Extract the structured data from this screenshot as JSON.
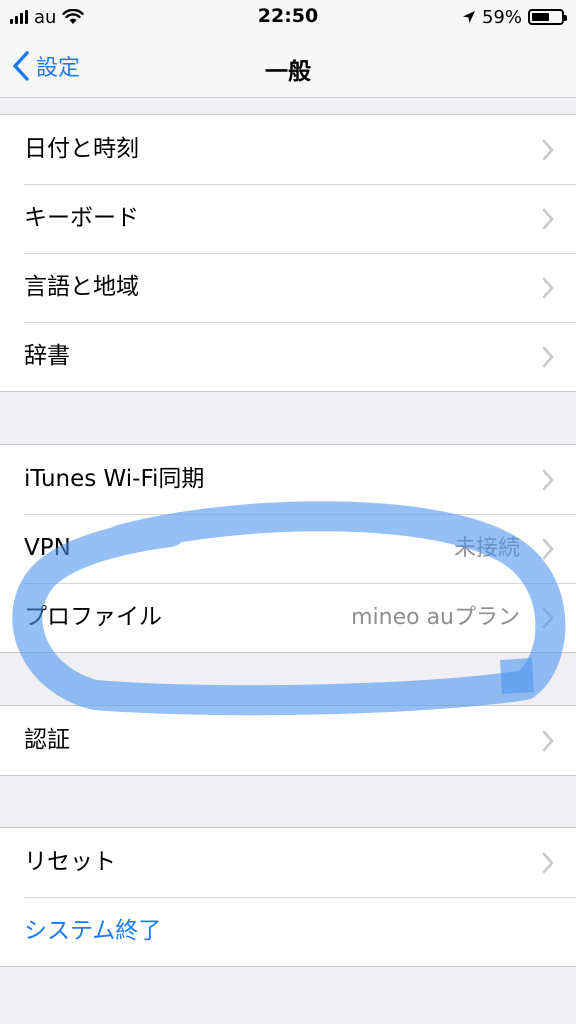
{
  "status_bar": {
    "carrier": "au",
    "time": "22:50",
    "battery_percent": "59%",
    "battery_level": 0.59,
    "icons": [
      "signal-bars-icon",
      "wifi-icon",
      "location-arrow-icon",
      "battery-icon"
    ]
  },
  "nav": {
    "back_label": "設定",
    "title": "一般"
  },
  "groups": [
    {
      "rows": [
        {
          "label": "日付と時刻"
        },
        {
          "label": "キーボード"
        },
        {
          "label": "言語と地域"
        },
        {
          "label": "辞書"
        }
      ]
    },
    {
      "rows": [
        {
          "label": "iTunes Wi-Fi同期"
        },
        {
          "label": "VPN",
          "value": "未接続"
        },
        {
          "label": "プロファイル",
          "value": "mineo auプラン"
        }
      ]
    },
    {
      "rows": [
        {
          "label": "認証"
        }
      ]
    },
    {
      "rows": [
        {
          "label": "リセット"
        },
        {
          "label": "システム終了"
        }
      ]
    }
  ],
  "colors": {
    "accent": "#1e7bf0",
    "background": "#efeff4",
    "secondary_text": "#8e8e93",
    "highlight_marker": "#4f94ee"
  }
}
